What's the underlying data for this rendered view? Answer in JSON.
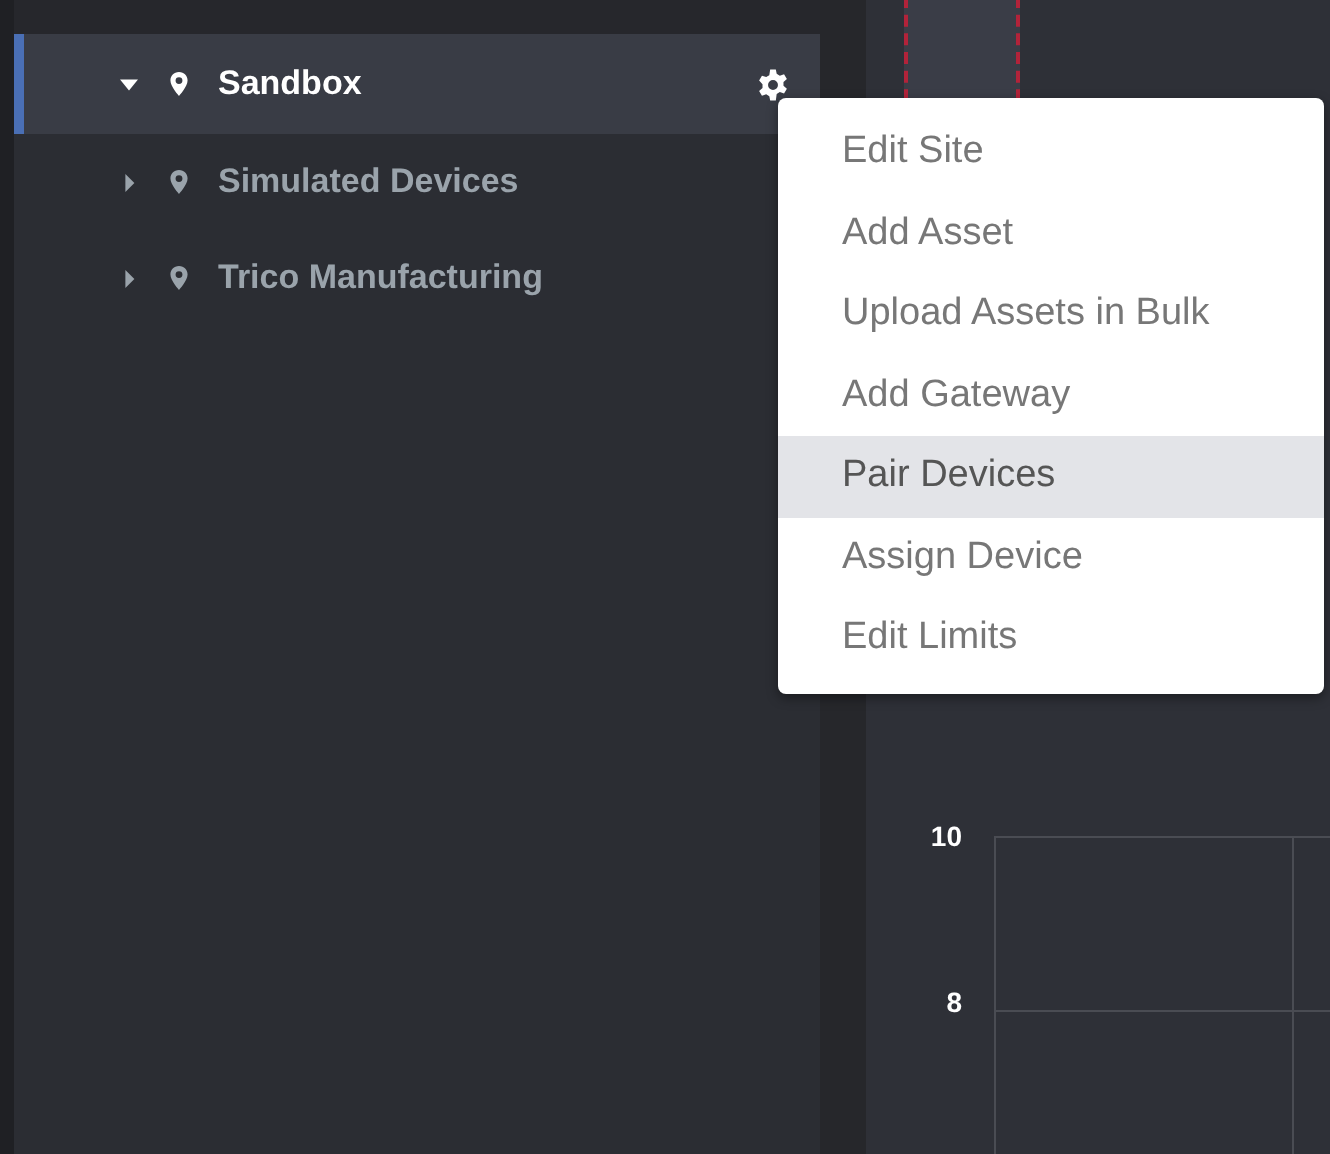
{
  "sidebar": {
    "sites": [
      {
        "name": "Sandbox",
        "expanded": true,
        "selected": true
      },
      {
        "name": "Simulated Devices",
        "expanded": false,
        "selected": false
      },
      {
        "name": "Trico Manufacturing",
        "expanded": false,
        "selected": false
      }
    ]
  },
  "context_menu": {
    "items": [
      {
        "label": "Edit Site",
        "selected": false
      },
      {
        "label": "Add Asset",
        "selected": false
      },
      {
        "label": "Upload Assets in Bulk",
        "selected": false
      },
      {
        "label": "Add Gateway",
        "selected": false
      },
      {
        "label": "Pair Devices",
        "selected": true
      },
      {
        "label": "Assign Device",
        "selected": false
      },
      {
        "label": "Edit Limits",
        "selected": false
      }
    ]
  },
  "chart": {
    "y_axis_labels": [
      "10",
      "8"
    ]
  }
}
